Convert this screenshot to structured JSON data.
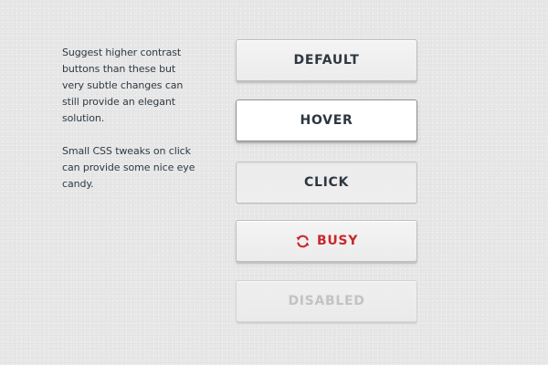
{
  "description": {
    "paragraph_1": "Suggest higher contrast buttons than these but very subtle changes can still provide an elegant solution.",
    "paragraph_2": "Small CSS tweaks on click can provide some nice eye candy."
  },
  "buttons": {
    "default_label": "DEFAULT",
    "hover_label": "HOVER",
    "click_label": "CLICK",
    "busy_label": "BUSY",
    "disabled_label": "DISABLED"
  },
  "icons": {
    "busy": "refresh-icon"
  },
  "colors": {
    "background": "#e9e9e9",
    "text": "#2e3740",
    "busy_accent": "#c8282c",
    "disabled_text": "#c3c3c3"
  }
}
